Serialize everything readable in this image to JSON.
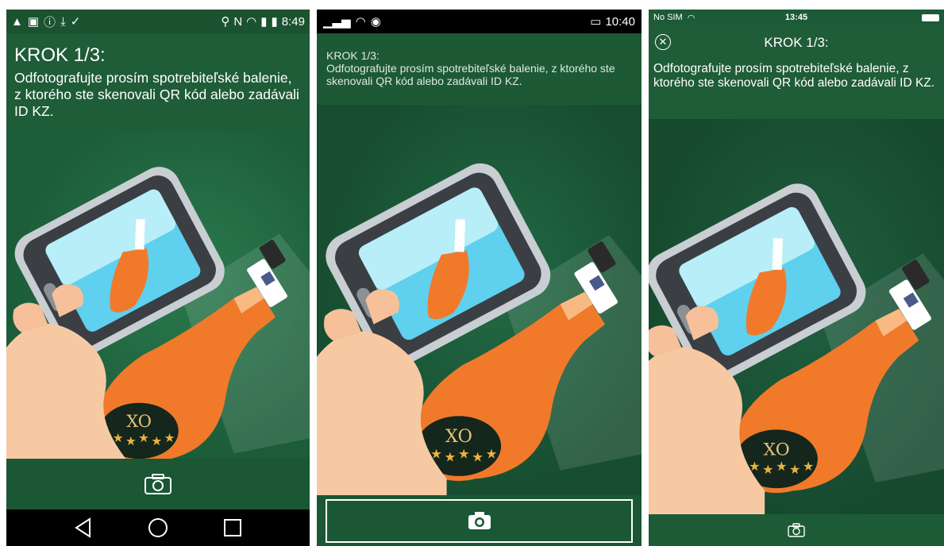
{
  "android_lollipop": {
    "status": {
      "time": "8:49"
    },
    "header": {
      "title": "KROK 1/3:",
      "instruction": "Odfotografujte prosím spotrebiteľské balenie, z ktorého ste skenovali QR kód alebo zadávali ID KZ."
    },
    "camera_icon": "camera-icon",
    "nav": {
      "back_icon": "back-triangle-icon",
      "home_icon": "home-circle-icon",
      "recents_icon": "recents-square-icon"
    }
  },
  "android_holo": {
    "status": {
      "time": "10:40"
    },
    "header": {
      "title": "KROK 1/3:",
      "instruction": "Odfotografujte prosím spotrebiteľské balenie, z ktorého ste skenovali QR kód alebo zadávali ID KZ."
    },
    "camera_icon": "camera-icon"
  },
  "ios": {
    "status": {
      "carrier": "No SIM",
      "time": "13:45"
    },
    "header": {
      "close_icon": "close-circle-icon",
      "title": "KROK 1/3:",
      "instruction": "Odfotografujte prosím spotrebiteľské balenie, z ktorého ste skenovali QR kód alebo zadávali ID KZ."
    },
    "camera_icon": "camera-icon"
  },
  "illustration": {
    "label_text": "XO",
    "bottle_color": "#f07a2a",
    "brand_green": "#1d5a37"
  }
}
